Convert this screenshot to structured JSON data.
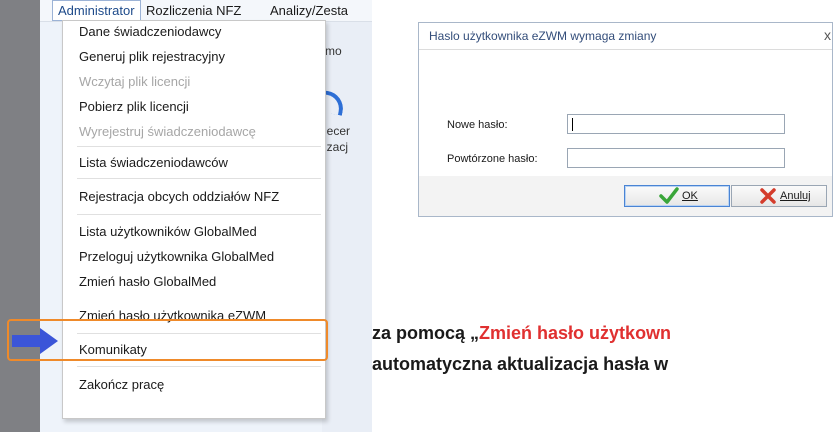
{
  "menubar": {
    "items": [
      "Administrator",
      "Rozliczenia NFZ",
      "Analizy/Zesta"
    ]
  },
  "background": {
    "labels": [
      "mo",
      "lecer",
      "izacj"
    ]
  },
  "menu": {
    "items": [
      {
        "label": "Dane świadczeniodawcy",
        "enabled": true
      },
      {
        "label": "Generuj plik rejestracyjny",
        "enabled": true
      },
      {
        "label": "Wczytaj plik licencji",
        "enabled": false
      },
      {
        "label": "Pobierz plik licencji",
        "enabled": true
      },
      {
        "label": "Wyrejestruj świadczeniodawcę",
        "enabled": false
      },
      {
        "label": "Lista świadczeniodawców",
        "enabled": true
      },
      {
        "label": "Rejestracja obcych oddziałów NFZ",
        "enabled": true
      },
      {
        "label": "Lista użytkowników GlobalMed",
        "enabled": true
      },
      {
        "label": "Przeloguj użytkownika GlobalMed",
        "enabled": true
      },
      {
        "label": "Zmień hasło GlobalMed",
        "enabled": true
      },
      {
        "label": "Zmień hasło użytkownika eZWM",
        "enabled": true,
        "highlighted": true
      },
      {
        "label": "Komunikaty",
        "enabled": true
      },
      {
        "label": "Zakończ pracę",
        "enabled": true
      }
    ]
  },
  "dialog": {
    "title": "Haslo użytkownika eZWM  wymaga zmiany",
    "close": "x",
    "new_password_label": "Nowe hasło:",
    "new_password_value": "",
    "repeat_password_label": "Powtórzone hasło:",
    "repeat_password_value": "",
    "ok_label": "OK",
    "cancel_label": "Anuluj"
  },
  "caption": {
    "line1_prefix": "za pomocą „",
    "line1_red": "Zmień hasło użytkown",
    "line2": "automatyczna aktualizacja hasła w"
  },
  "colors": {
    "highlight_border": "#ef8a2a",
    "arrow": "#3b55d8",
    "caption_red": "#e03030",
    "ok_check": "#3aa63a",
    "cancel_x": "#d43c2c"
  }
}
